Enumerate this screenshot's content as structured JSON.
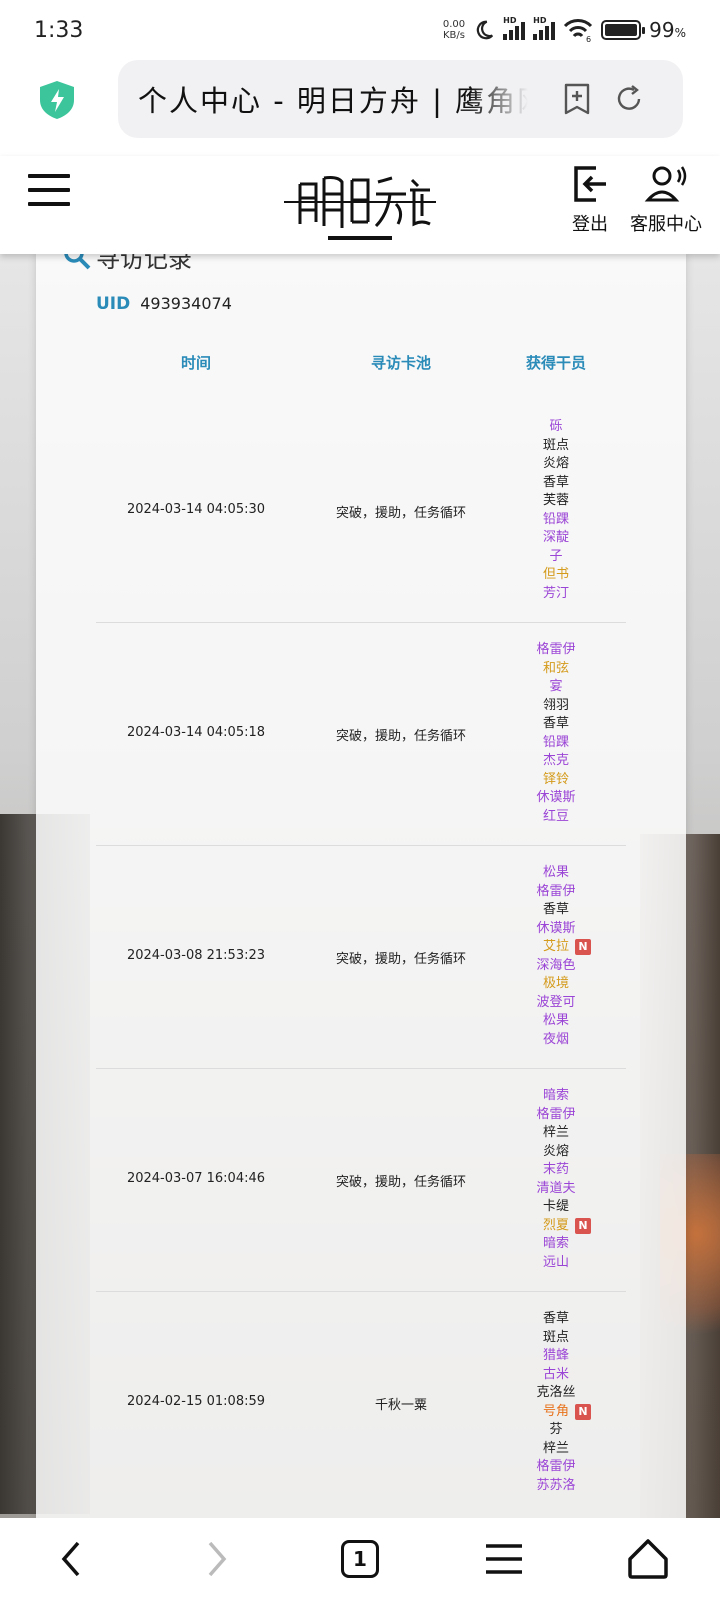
{
  "status_bar": {
    "time": "1:33",
    "net_speed_value": "0.00",
    "net_speed_unit": "KB/s",
    "hd1": "HD",
    "hd2": "HD",
    "wifi_sub": "6",
    "battery": "99",
    "battery_unit": "%"
  },
  "browser": {
    "url_title": "个人中心 - 明日方舟 | 鹰角网络"
  },
  "header": {
    "logout_label": "登出",
    "service_label": "客服中心"
  },
  "records": {
    "section_title": "寻访记录",
    "uid_label": "UID",
    "uid_value": "493934074",
    "columns": [
      "时间",
      "寻访卡池",
      "获得干员"
    ],
    "rows": [
      {
        "time": "2024-03-14 04:05:30",
        "pool": "突破，援助，任务循环",
        "operators": [
          {
            "name": "砾",
            "rarity": "purple"
          },
          {
            "name": "斑点",
            "rarity": "white"
          },
          {
            "name": "炎熔",
            "rarity": "white"
          },
          {
            "name": "香草",
            "rarity": "white"
          },
          {
            "name": "芙蓉",
            "rarity": "white"
          },
          {
            "name": "铅踝",
            "rarity": "purple"
          },
          {
            "name": "深靛",
            "rarity": "purple"
          },
          {
            "name": "子",
            "rarity": "purple"
          },
          {
            "name": "但书",
            "rarity": "gold"
          },
          {
            "name": "芳汀",
            "rarity": "purple"
          }
        ]
      },
      {
        "time": "2024-03-14 04:05:18",
        "pool": "突破，援助，任务循环",
        "operators": [
          {
            "name": "格雷伊",
            "rarity": "purple"
          },
          {
            "name": "和弦",
            "rarity": "gold"
          },
          {
            "name": "宴",
            "rarity": "purple"
          },
          {
            "name": "翎羽",
            "rarity": "white"
          },
          {
            "name": "香草",
            "rarity": "white"
          },
          {
            "name": "铅踝",
            "rarity": "purple"
          },
          {
            "name": "杰克",
            "rarity": "purple"
          },
          {
            "name": "铎铃",
            "rarity": "gold"
          },
          {
            "name": "休谟斯",
            "rarity": "purple"
          },
          {
            "name": "红豆",
            "rarity": "purple"
          }
        ]
      },
      {
        "time": "2024-03-08 21:53:23",
        "pool": "突破，援助，任务循环",
        "operators": [
          {
            "name": "松果",
            "rarity": "purple"
          },
          {
            "name": "格雷伊",
            "rarity": "purple"
          },
          {
            "name": "香草",
            "rarity": "white"
          },
          {
            "name": "休谟斯",
            "rarity": "purple"
          },
          {
            "name": "艾拉",
            "rarity": "gold",
            "new": "N"
          },
          {
            "name": "深海色",
            "rarity": "purple"
          },
          {
            "name": "极境",
            "rarity": "gold"
          },
          {
            "name": "波登可",
            "rarity": "purple"
          },
          {
            "name": "松果",
            "rarity": "purple"
          },
          {
            "name": "夜烟",
            "rarity": "purple"
          }
        ]
      },
      {
        "time": "2024-03-07 16:04:46",
        "pool": "突破，援助，任务循环",
        "operators": [
          {
            "name": "暗索",
            "rarity": "purple"
          },
          {
            "name": "格雷伊",
            "rarity": "purple"
          },
          {
            "name": "梓兰",
            "rarity": "white"
          },
          {
            "name": "炎熔",
            "rarity": "white"
          },
          {
            "name": "末药",
            "rarity": "purple"
          },
          {
            "name": "清道夫",
            "rarity": "purple"
          },
          {
            "name": "卡缇",
            "rarity": "white"
          },
          {
            "name": "烈夏",
            "rarity": "gold",
            "new": "N"
          },
          {
            "name": "暗索",
            "rarity": "purple"
          },
          {
            "name": "远山",
            "rarity": "purple"
          }
        ]
      },
      {
        "time": "2024-02-15 01:08:59",
        "pool": "千秋一粟",
        "operators": [
          {
            "name": "香草",
            "rarity": "white"
          },
          {
            "name": "斑点",
            "rarity": "white"
          },
          {
            "name": "猎蜂",
            "rarity": "purple"
          },
          {
            "name": "古米",
            "rarity": "purple"
          },
          {
            "name": "克洛丝",
            "rarity": "white"
          },
          {
            "name": "号角",
            "rarity": "orange",
            "new": "N"
          },
          {
            "name": "芬",
            "rarity": "white"
          },
          {
            "name": "梓兰",
            "rarity": "white"
          },
          {
            "name": "格雷伊",
            "rarity": "purple"
          },
          {
            "name": "苏苏洛",
            "rarity": "purple"
          }
        ]
      }
    ]
  },
  "bottom_nav": {
    "tab_count": "1"
  }
}
